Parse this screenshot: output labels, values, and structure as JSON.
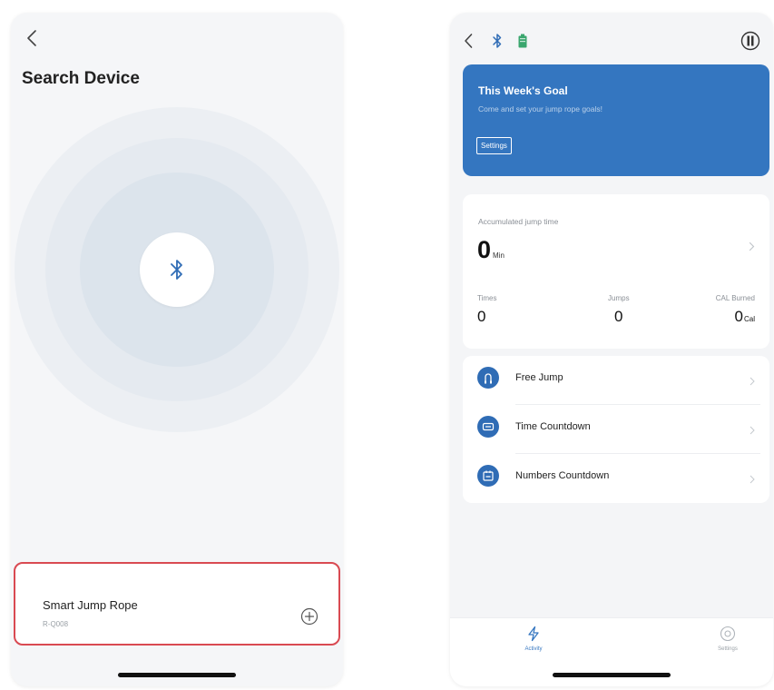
{
  "left_screen": {
    "title": "Search Device",
    "device": {
      "name": "Smart Jump Rope",
      "id": "R-Q008"
    },
    "icons": [
      "back-arrow-icon",
      "bluetooth-icon",
      "add-circle-icon"
    ]
  },
  "right_screen": {
    "goal": {
      "title": "This Week's Goal",
      "subtitle": "Come and set your jump rope goals!",
      "button_label": "Settings"
    },
    "stats": {
      "accumulated_label": "Accumulated jump time",
      "accumulated_value": "0",
      "accumulated_unit": "Min",
      "times_label": "Times",
      "times_value": "0",
      "jumps_label": "Jumps",
      "jumps_value": "0",
      "cal_label": "CAL Burned",
      "cal_value": "0",
      "cal_unit": "Cal"
    },
    "modes": [
      {
        "label": "Free Jump",
        "icon": "jump-rope-icon"
      },
      {
        "label": "Time Countdown",
        "icon": "timer-icon"
      },
      {
        "label": "Numbers Countdown",
        "icon": "counter-icon"
      }
    ],
    "tabs": [
      {
        "label": "Activity",
        "icon": "lightning-icon",
        "active": true
      },
      {
        "label": "Settings",
        "icon": "settings-circle-icon",
        "active": false
      }
    ],
    "colors": {
      "accent": "#3476c0",
      "highlight_border": "#d94a52",
      "battery": "#3aa66e"
    }
  }
}
